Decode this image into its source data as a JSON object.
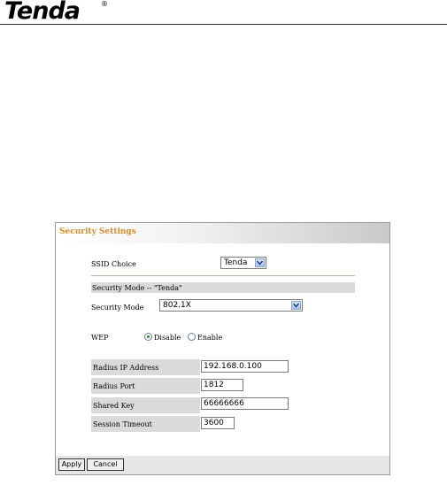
{
  "brand": {
    "name": "Tenda",
    "registered_mark": "®"
  },
  "panel": {
    "title": "Security Settings"
  },
  "ssid": {
    "label": "SSID Choice",
    "value": "Tenda"
  },
  "security_section": {
    "header": "Security Mode -- \"Tenda\""
  },
  "security_mode": {
    "label": "Security Mode",
    "value": "802.1X"
  },
  "wep": {
    "label": "WEP",
    "options": [
      "Disable",
      "Enable"
    ],
    "selected": "Disable"
  },
  "radius": {
    "ip_label": "Radius IP Address",
    "ip_value": "192.168.0.100",
    "port_label": "Radius Port",
    "port_value": "1812",
    "key_label": "Shared Key",
    "key_value": "66666666",
    "timeout_label": "Session Timeout",
    "timeout_value": "3600"
  },
  "buttons": {
    "apply": "Apply",
    "cancel": "Cancel"
  },
  "colors": {
    "title_accent": "#d98e2b",
    "radio_selected": "#2c8a2c"
  }
}
